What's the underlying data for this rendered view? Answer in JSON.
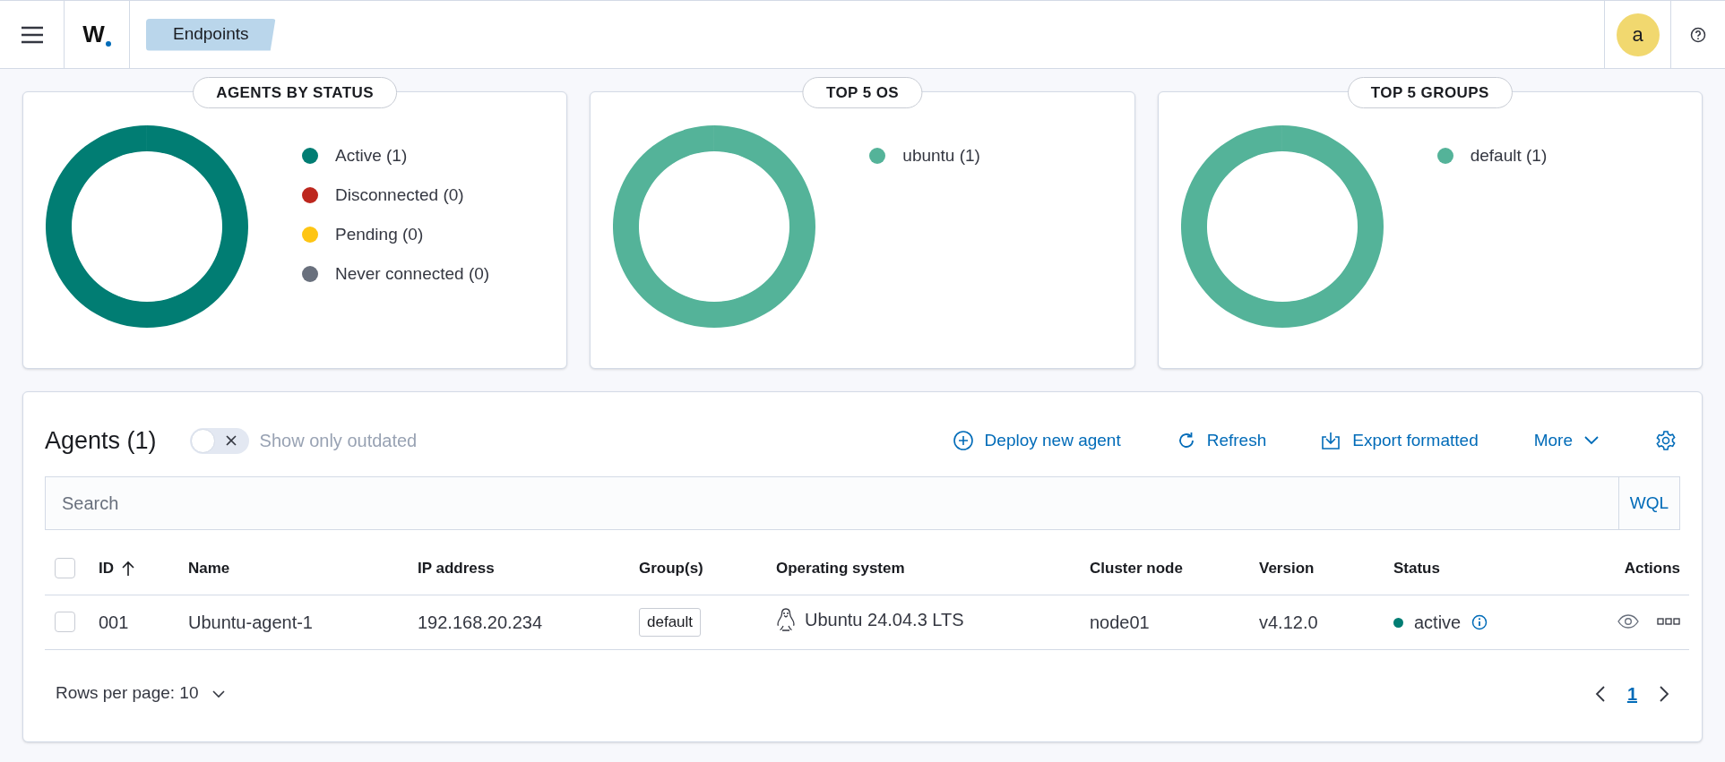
{
  "header": {
    "breadcrumb": "Endpoints",
    "logo": "W",
    "avatar": "a"
  },
  "cards": [
    {
      "title": "AGENTS BY STATUS",
      "legend": [
        {
          "color": "#017d73"
        },
        {
          "color": "#bd271e"
        },
        {
          "color": "#fec514"
        },
        {
          "color": "#69707d"
        }
      ],
      "chart_data": {
        "type": "donut",
        "categories": [
          "Active (1)",
          "Disconnected (0)",
          "Pending (0)",
          "Never connected (0)"
        ],
        "values": [
          1,
          0,
          0,
          0
        ]
      }
    },
    {
      "title": "TOP 5 OS",
      "legend": [
        {
          "color": "#54b399"
        }
      ],
      "chart_data": {
        "type": "donut",
        "categories": [
          "ubuntu (1)"
        ],
        "values": [
          1
        ]
      }
    },
    {
      "title": "TOP 5 GROUPS",
      "legend": [
        {
          "color": "#54b399"
        }
      ],
      "chart_data": {
        "type": "donut",
        "categories": [
          "default (1)"
        ],
        "values": [
          1
        ]
      }
    }
  ],
  "agents": {
    "title": "Agents (1)",
    "outdated_toggle": {
      "label": "Show only outdated",
      "on": false
    },
    "actions": [
      {
        "kind": "deploy",
        "label": "Deploy new agent"
      },
      {
        "kind": "refresh",
        "label": "Refresh"
      },
      {
        "kind": "export",
        "label": "Export formatted"
      },
      {
        "kind": "more",
        "label": "More"
      }
    ],
    "search": {
      "placeholder": "Search",
      "language": "WQL"
    },
    "columns": [
      "ID",
      "Name",
      "IP address",
      "Group(s)",
      "Operating system",
      "Cluster node",
      "Version",
      "Status",
      "Actions"
    ],
    "select_all_checked": false,
    "rows": [
      {
        "checked": false,
        "id": "001",
        "name": "Ubuntu-agent-1",
        "ip": "192.168.20.234",
        "group": "default",
        "os": "Ubuntu 24.04.3 LTS",
        "node": "node01",
        "version": "v4.12.0",
        "status": "active",
        "color": "#017d73"
      }
    ],
    "rows_per_page": "Rows per page: 10",
    "pages": [
      {
        "label": "1",
        "selected": true
      }
    ]
  }
}
